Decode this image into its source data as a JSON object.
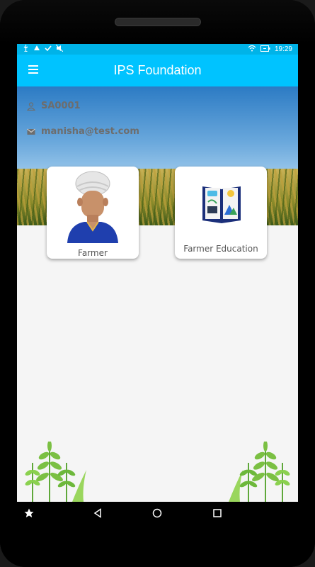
{
  "status_bar": {
    "time": "19:29",
    "left_icons": [
      "usb-icon",
      "drive-icon",
      "check-icon",
      "mute-icon"
    ],
    "right_icons": [
      "wifi-icon",
      "battery-icon"
    ]
  },
  "app_bar": {
    "title": "IPS Foundation",
    "menu_icon": "menu-icon",
    "color": "#00c3ff"
  },
  "user": {
    "id": "SA0001",
    "email": "manisha@test.com"
  },
  "cards": [
    {
      "label": "Farmer",
      "icon": "farmer-avatar-icon"
    },
    {
      "label": "Farmer Education",
      "icon": "education-book-icon"
    }
  ],
  "nav_bar": {
    "icons": [
      "star-icon",
      "back-icon",
      "home-icon",
      "recents-icon"
    ]
  }
}
